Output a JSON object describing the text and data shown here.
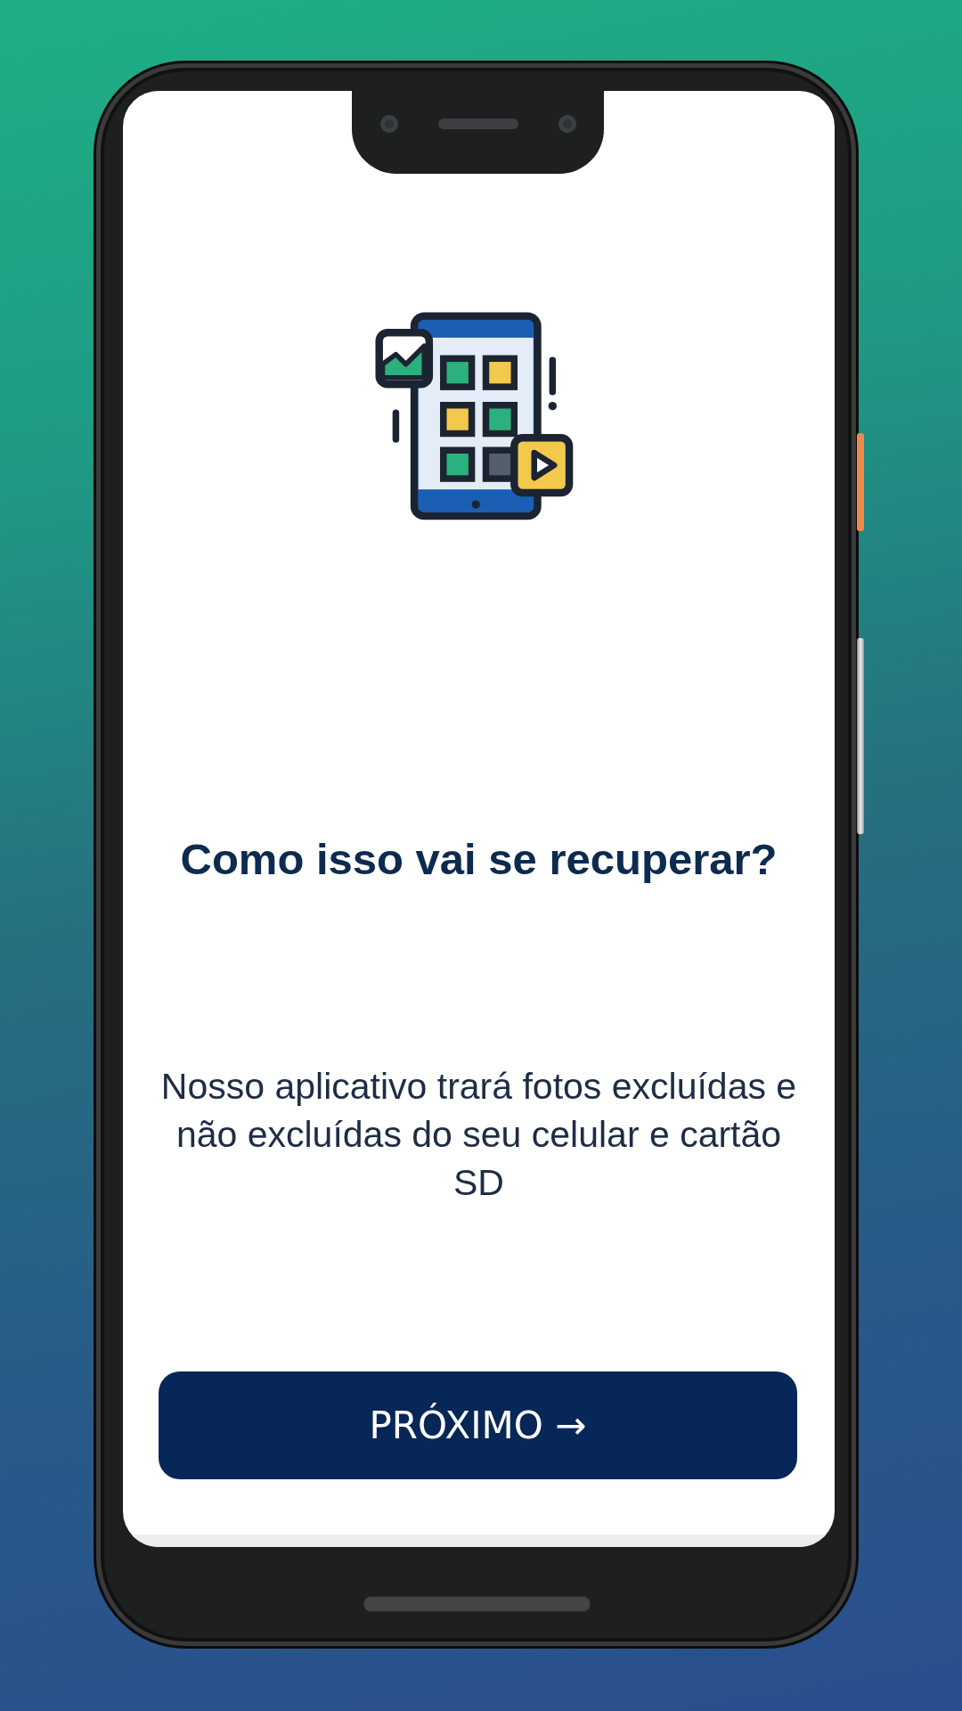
{
  "screen": {
    "title": "Como isso vai se recuperar?",
    "description": "Nosso aplicativo trará fotos excluídas e não excluídas do seu celular e cartão SD",
    "button": {
      "label": "PRÓXIMO →"
    }
  }
}
